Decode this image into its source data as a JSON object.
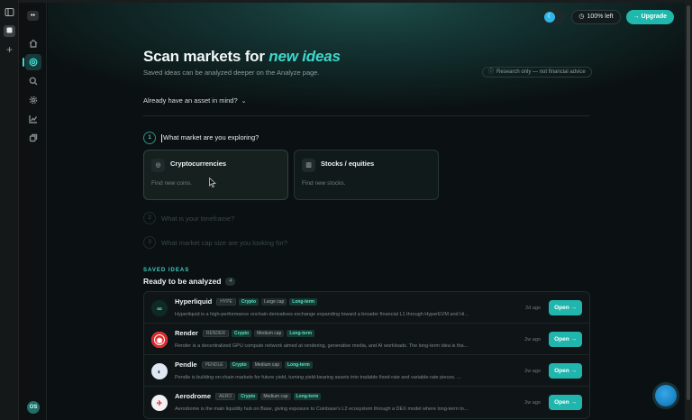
{
  "sidebar": {
    "logo": "••",
    "items": [
      {
        "name": "home",
        "icon": "home-icon"
      },
      {
        "name": "scan",
        "icon": "scan-icon",
        "active": true
      },
      {
        "name": "search",
        "icon": "search-icon"
      },
      {
        "name": "settings",
        "icon": "gear-icon"
      },
      {
        "name": "analytics",
        "icon": "chart-icon"
      },
      {
        "name": "library",
        "icon": "copy-icon"
      }
    ],
    "avatar": "OS"
  },
  "topbar": {
    "credits": "100% left",
    "upgrade": "Upgrade"
  },
  "header": {
    "title_prefix": "Scan markets for",
    "title_accent": "new ideas",
    "subtitle": "Saved ideas can be analyzed deeper on the Analyze page.",
    "disclaimer": "Research only — not financial advice"
  },
  "asset_prompt": "Already have an asset in mind?",
  "steps": [
    {
      "num": "1",
      "label": "What market are you exploring?"
    },
    {
      "num": "2",
      "label": "What is your timeframe?"
    },
    {
      "num": "3",
      "label": "What market cap size are you looking for?"
    }
  ],
  "markets": [
    {
      "title": "Cryptocurrencies",
      "desc": "Find new coins.",
      "icon": "coin-icon"
    },
    {
      "title": "Stocks / equities",
      "desc": "Find new stocks.",
      "icon": "building-icon"
    }
  ],
  "saved": {
    "kicker": "SAVED IDEAS",
    "title": "Ready to be analyzed",
    "count": "4",
    "open_label": "Open",
    "items": [
      {
        "name": "Hyperliquid",
        "symbol": "HYPE",
        "category": "Crypto",
        "cap": "Large cap",
        "term": "Long-term",
        "age": "2d ago",
        "desc": "Hyperliquid is a high-performance onchain derivatives exchange expanding toward a broader financial L1 through HyperEVM and Hi...",
        "color": "#0f2a26"
      },
      {
        "name": "Render",
        "symbol": "RENDER",
        "category": "Crypto",
        "cap": "Medium cap",
        "term": "Long-term",
        "age": "2w ago",
        "desc": "Render is a decentralized GPU compute network aimed at rendering, generative media, and AI workloads. The long-term idea is tha...",
        "color": "#e0282b"
      },
      {
        "name": "Pendle",
        "symbol": "PENDLE",
        "category": "Crypto",
        "cap": "Medium cap",
        "term": "Long-term",
        "age": "2w ago",
        "desc": "Pendle is building on-chain markets for future yield, turning yield-bearing assets into tradable fixed-rate and variable-rate pieces. ...",
        "color": "#dfe7f3"
      },
      {
        "name": "Aerodrome",
        "symbol": "AERO",
        "category": "Crypto",
        "cap": "Medium cap",
        "term": "Long-term",
        "age": "2w ago",
        "desc": "Aerodrome is the main liquidity hub on Base, giving exposure to Coinbase's L2 ecosystem through a DEX model where long-term to...",
        "color": "#f2f2f2"
      }
    ]
  }
}
